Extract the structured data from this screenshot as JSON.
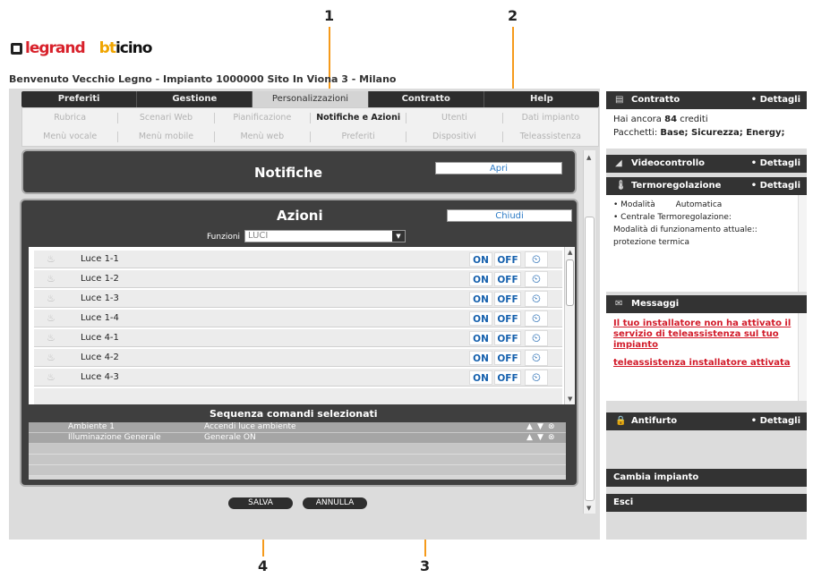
{
  "callouts": [
    "1",
    "2",
    "3",
    "4"
  ],
  "brand": {
    "logo1": "legrand",
    "logo2_a": "bt",
    "logo2_b": "icino"
  },
  "welcome": "Benvenuto Vecchio Legno - Impianto 1000000 Sito In Viona 3 - Milano",
  "tabs": [
    {
      "label": "Preferiti"
    },
    {
      "label": "Gestione"
    },
    {
      "label": "Personalizzazioni",
      "active": true
    },
    {
      "label": "Contratto"
    },
    {
      "label": "Help"
    }
  ],
  "submenu_row1": [
    {
      "label": "Rubrica"
    },
    {
      "label": "Scenari Web"
    },
    {
      "label": "Pianificazione"
    },
    {
      "label": "Notifiche e Azioni",
      "active": true
    },
    {
      "label": "Utenti"
    },
    {
      "label": "Dati impianto"
    }
  ],
  "submenu_row2": [
    {
      "label": "Menù vocale"
    },
    {
      "label": "Menù mobile"
    },
    {
      "label": "Menù web"
    },
    {
      "label": "Preferiti"
    },
    {
      "label": "Dispositivi"
    },
    {
      "label": "Teleassistenza"
    }
  ],
  "notifiche": {
    "title": "Notifiche",
    "open_btn": "Apri"
  },
  "azioni": {
    "title": "Azioni",
    "close_btn": "Chiudi",
    "funzioni_label": "Funzioni",
    "funzioni_value": "LUCI",
    "on_label": "ON",
    "off_label": "OFF",
    "items": [
      {
        "name": "Luce 1-1"
      },
      {
        "name": "Luce 1-2"
      },
      {
        "name": "Luce 1-3"
      },
      {
        "name": "Luce 1-4"
      },
      {
        "name": "Luce 4-1"
      },
      {
        "name": "Luce 4-2"
      },
      {
        "name": "Luce 4-3"
      }
    ]
  },
  "sequenza": {
    "title": "Sequenza comandi selezionati",
    "rows": [
      {
        "ambiente": "Ambiente 1",
        "comando": "Accendi luce ambiente"
      },
      {
        "ambiente": "Illuminazione Generale",
        "comando": "Generale ON"
      }
    ]
  },
  "buttons": {
    "salva": "SALVA",
    "annulla": "ANNULLA"
  },
  "sidebar": {
    "contratto": {
      "title": "Contratto",
      "details": "• Dettagli",
      "crediti_pre": "Hai ancora",
      "crediti_num": "84",
      "crediti_post": "crediti",
      "pacchetti_label": "Pacchetti:",
      "pacchetti_value": "Base; Sicurezza; Energy;"
    },
    "video": {
      "title": "Videocontrollo",
      "details": "• Dettagli"
    },
    "termo": {
      "title": "Termoregolazione",
      "details": "• Dettagli",
      "modalita_label": "• Modalità",
      "modalita_value": "Automatica",
      "centrale": "• Centrale Termoregolazione:",
      "funz": "Modalità di funzionamento attuale::",
      "prot": "protezione termica"
    },
    "messaggi": {
      "title": "Messaggi",
      "msg1": "Il tuo installatore non ha attivato il servizio di teleassistenza sul tuo impianto",
      "msg2": "teleassistenza installatore attivata"
    },
    "antifurto": {
      "title": "Antifurto",
      "details": "• Dettagli"
    },
    "cambia": "Cambia impianto",
    "esci": "Esci"
  }
}
